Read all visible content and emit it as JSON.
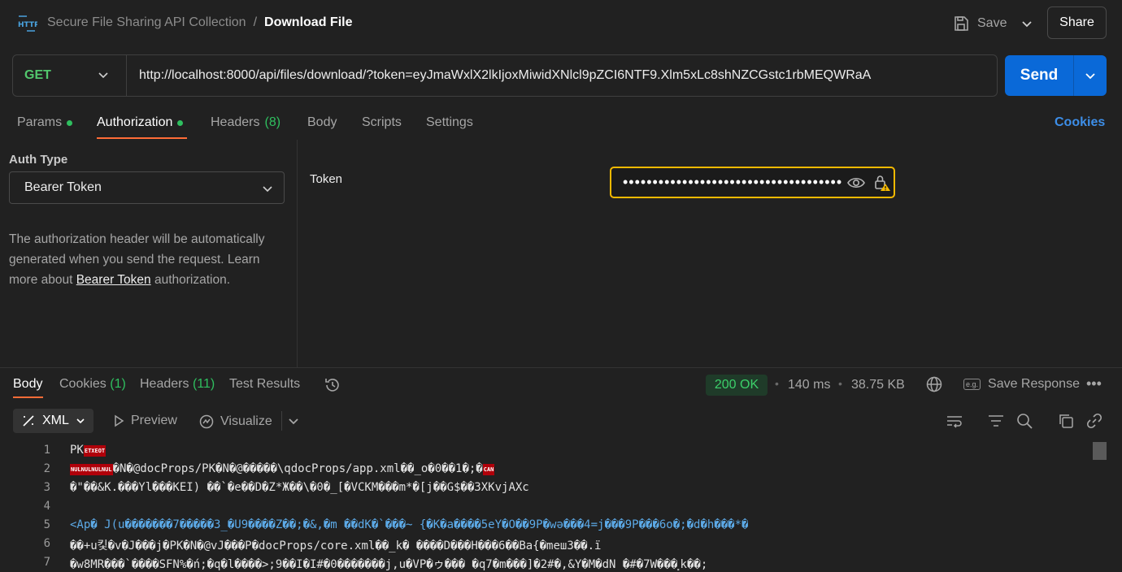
{
  "breadcrumb": {
    "collection": "Secure File Sharing API Collection",
    "separator": "/",
    "current": "Download File"
  },
  "header": {
    "save_label": "Save",
    "share_label": "Share",
    "http_icon": "HTTP"
  },
  "request": {
    "method": "GET",
    "url": "http://localhost:8000/api/files/download/?token=eyJmaWxlX2lkIjoxMiwidXNlcl9pZCI6NTF9.Xlm5xLc8shNZCGstc1rbMEQWRaA",
    "send_label": "Send"
  },
  "request_tabs": {
    "params": "Params",
    "authorization": "Authorization",
    "headers": "Headers",
    "headers_count": "(8)",
    "body": "Body",
    "scripts": "Scripts",
    "settings": "Settings",
    "cookies": "Cookies"
  },
  "auth": {
    "type_label": "Auth Type",
    "type_value": "Bearer Token",
    "help_before": "The authorization header will be automatically generated when you send the request. Learn more about ",
    "help_link": "Bearer Token",
    "help_after": " authorization.",
    "token_label": "Token",
    "token_masked": "••••••••••••••••••••••••••••••••••••••••"
  },
  "response_tabs": {
    "body": "Body",
    "cookies": "Cookies",
    "cookies_count": "(1)",
    "headers": "Headers",
    "headers_count": "(11)",
    "test_results": "Test Results"
  },
  "response_meta": {
    "status": "200 OK",
    "time": "140 ms",
    "size": "38.75 KB",
    "save_response": "Save Response",
    "eg": "e.g."
  },
  "format_toolbar": {
    "format": "XML",
    "preview": "Preview",
    "visualize": "Visualize"
  },
  "colors": {
    "accent_orange": "#ff6c37",
    "send_blue": "#0a69d8",
    "success_green": "#3ccf6a",
    "warning_yellow": "#f5b900"
  },
  "code_lines": {
    "l1": {
      "n": "1",
      "text": "PK"
    },
    "l2": {
      "n": "2",
      "text": "�N�@docProps/PK�N�@�����\\qdocProps/app.xml��_o�0��1�;�"
    },
    "l3": {
      "n": "3",
      "text": "�\"��&K.���Yl���KEI) ��`�e��D�Z*Ж��\\�0�_[�VCKM���m*�[j��G$��3XKvjAXc"
    },
    "l4": {
      "n": "4",
      "text": ""
    },
    "l5": {
      "n": "5",
      "text": "<Ap� J(u�������7�����3_�U9����Z��;�&,�m    ��dK�`���~ {�K�a����5eY�O��9P�wə���4=j���9P���6o�;�d�h���*�"
    },
    "l6": {
      "n": "6",
      "text": "��+u킻�v�J���j�PK�N�@vJ���P�docProps/core.xml��_k� ����D���H���6��Ba{�meш3��.ї"
    },
    "l7": {
      "n": "7",
      "text": "�w8MR���`����SFN%�ń;�q�l����>;9��I�I#�0�������j,u�VP�ゥ��� �q7�m���]�2#�,&Y�M�dN      �#�7W���⸼k��;"
    }
  }
}
